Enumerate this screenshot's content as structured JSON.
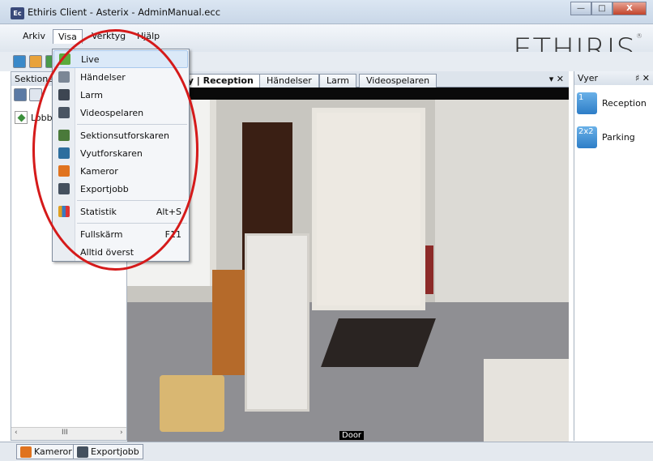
{
  "window": {
    "title": "Ethiris Client - Asterix - AdminManual.ecc",
    "icon": "Ec",
    "minimize": "—",
    "maximize": "□",
    "close": "X"
  },
  "menubar": {
    "items": [
      "Arkiv",
      "Visa",
      "Verktyg",
      "Hjälp"
    ],
    "logo": "ETHIRIS",
    "logo_mark": "®"
  },
  "visa_menu": {
    "items": [
      {
        "label": "Live",
        "shortcut": "",
        "icon": "live-icon"
      },
      {
        "label": "Händelser",
        "shortcut": "",
        "icon": "events-icon"
      },
      {
        "label": "Larm",
        "shortcut": "",
        "icon": "alarm-icon"
      },
      {
        "label": "Videospelaren",
        "shortcut": "",
        "icon": "videoplayer-icon"
      },
      {
        "label": "Sektionsutforskaren",
        "shortcut": "",
        "icon": "section-explorer-icon"
      },
      {
        "label": "Vyutforskaren",
        "shortcut": "",
        "icon": "view-explorer-icon"
      },
      {
        "label": "Kameror",
        "shortcut": "",
        "icon": "camera-icon"
      },
      {
        "label": "Exportjobb",
        "shortcut": "",
        "icon": "export-icon"
      },
      {
        "label": "Statistik",
        "shortcut": "Alt+S",
        "icon": "statistics-icon"
      },
      {
        "label": "Fullskärm",
        "shortcut": "F11",
        "icon": ""
      },
      {
        "label": "Alltid överst",
        "shortcut": "",
        "icon": ""
      }
    ]
  },
  "left_panel": {
    "header": "Sektione",
    "tree_item": "Lobb",
    "scroll_mid": "III"
  },
  "tabs": {
    "items": [
      "bby | Reception",
      "Händelser",
      "Larm",
      "Videospelaren"
    ],
    "controls": "▾ ✕"
  },
  "video": {
    "camera_label": "Door"
  },
  "right_panel": {
    "header": "Vyer",
    "header_controls": "♯ ✕",
    "views": [
      {
        "icon_text": "1",
        "label": "Reception"
      },
      {
        "icon_text": "2x2",
        "label": "Parking"
      }
    ]
  },
  "bottom_tabs": [
    "Kameror",
    "Exportjobb"
  ],
  "colors": {
    "highlight": "#dbe9f8",
    "annotation": "#d51a1a",
    "view_icon": "#2d7dc7"
  }
}
